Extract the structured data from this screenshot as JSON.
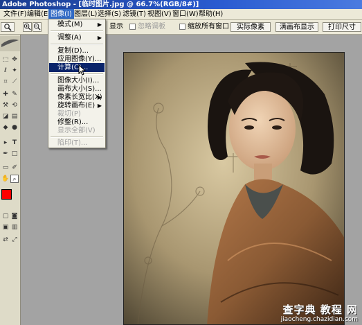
{
  "window": {
    "title": "Adobe Photoshop - [临时图片.jpg @ 66.7%(RGB/8#)]"
  },
  "menubar": {
    "items": [
      "文件(F)",
      "编辑(E)",
      "图像(I)",
      "图层(L)",
      "选择(S)",
      "滤镜(T)",
      "视图(V)",
      "窗口(W)",
      "帮助(H)"
    ]
  },
  "options": {
    "fit_screen_label": "显示",
    "ignore_palettes_label": "忽略调板",
    "zoom_all_label": "缩放所有窗口",
    "actual_pixels": "实际像素",
    "fit_on_screen": "满画布显示",
    "print_size": "打印尺寸"
  },
  "image_menu": {
    "items": [
      {
        "label": "模式(M)",
        "submenu": true
      },
      {
        "label": "调整(A)",
        "submenu": true
      },
      {
        "label": "复制(D)..."
      },
      {
        "label": "应用图像(Y)..."
      },
      {
        "label": "计算(C)...",
        "highlight": true
      },
      {
        "label": "图像大小(I)..."
      },
      {
        "label": "画布大小(S)..."
      },
      {
        "label": "像素长宽比(X)",
        "submenu": true
      },
      {
        "label": "旋转画布(E)",
        "submenu": true
      },
      {
        "label": "裁切(P)",
        "disabled": true
      },
      {
        "label": "修整(R)..."
      },
      {
        "label": "显示全部(V)",
        "disabled": true
      },
      {
        "label": "陷印(T)...",
        "disabled": true
      }
    ]
  },
  "watermark": {
    "main": "查字典 教程 网",
    "sub": "jiaocheng.chazidian.com"
  },
  "colors": {
    "foreground": "#ff0000",
    "background": "#ffffff",
    "menu_highlight": "#0a246a"
  }
}
